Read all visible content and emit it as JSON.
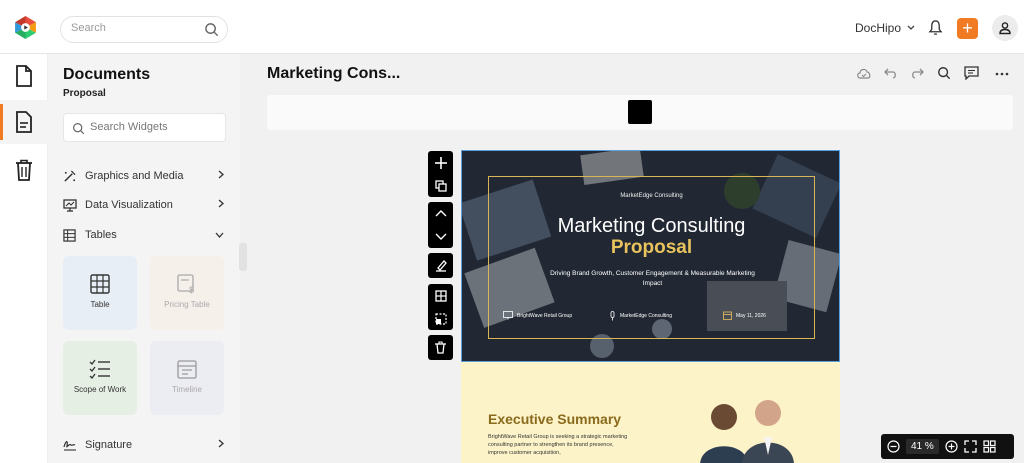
{
  "header": {
    "search_placeholder": "Search",
    "brand": "DocHipo",
    "add_label": "+"
  },
  "panel": {
    "title": "Documents",
    "subtitle": "Proposal",
    "widget_search_placeholder": "Search Widgets",
    "categories": [
      {
        "label": "Graphics and Media",
        "icon": "magic-wand-icon"
      },
      {
        "label": "Data Visualization",
        "icon": "chart-monitor-icon"
      },
      {
        "label": "Tables",
        "icon": "table-icon"
      }
    ],
    "tiles": [
      {
        "label": "Table",
        "icon": "table-icon",
        "bg": "#e8eef5"
      },
      {
        "label": "Pricing Table",
        "icon": "pricing-table-icon",
        "bg": "#f6f0eb"
      },
      {
        "label": "Scope of Work",
        "icon": "checklist-icon",
        "bg": "#e6efe4"
      },
      {
        "label": "Timeline",
        "icon": "calendar-icon",
        "bg": "#ececf3"
      }
    ],
    "signature_label": "Signature"
  },
  "editor": {
    "doc_title": "Marketing Cons...",
    "zoom_value": "41 %"
  },
  "cover": {
    "company": "MarketEdge Consulting",
    "title_line1": "Marketing Consulting",
    "title_line2": "Proposal",
    "tagline": "Driving Brand Growth, Customer Engagement & Measurable Marketing Impact",
    "footer_client": "BrightWave Retail Group",
    "footer_presenter": "MarketEdge Consulting",
    "footer_date": "May 11, 2026"
  },
  "executive": {
    "title": "Executive Summary",
    "body": "BrightWave Retail Group is seeking a strategic marketing consulting partner to strengthen its brand presence, improve customer acquisition,"
  },
  "colors": {
    "accent": "#f07b22",
    "gold": "#e8c35d",
    "page_bg": "#fdf3c8"
  }
}
